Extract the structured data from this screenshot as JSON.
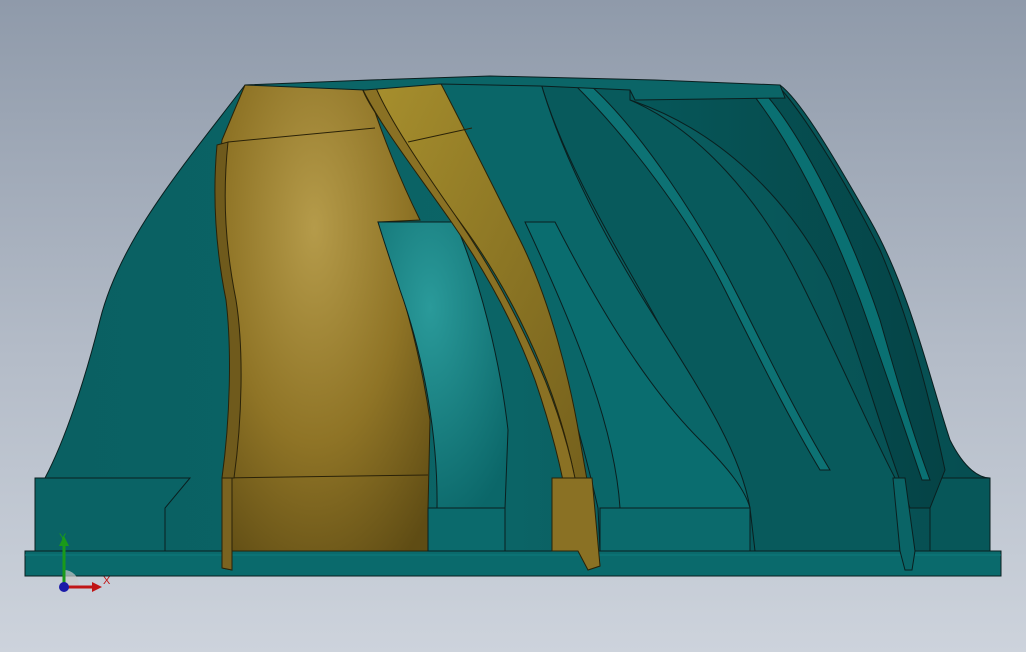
{
  "viewport": {
    "background_top": "#8f9aaa",
    "background_bottom": "#cdd3dc"
  },
  "model": {
    "teal_color": "#0c6e70",
    "teal_dark": "#054a4d",
    "gold_color": "#a38a35",
    "gold_dark": "#6b5718"
  },
  "triad": {
    "y_label": "Y",
    "x_label": "X",
    "y_color": "#1a9a1a",
    "x_color": "#c01515",
    "z_color": "#1a1aa8"
  }
}
